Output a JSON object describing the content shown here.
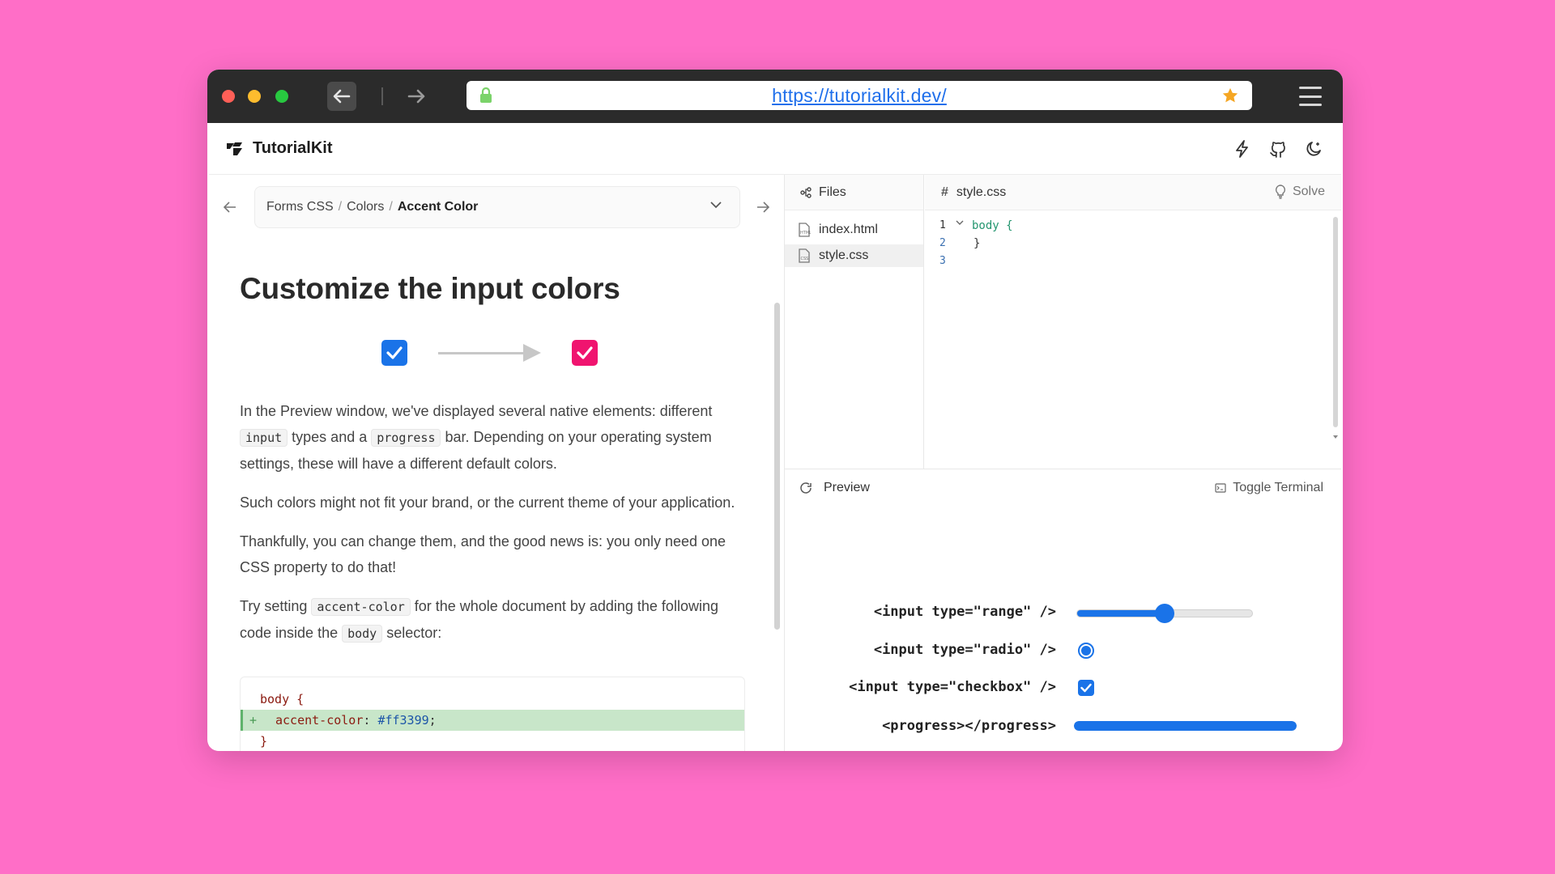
{
  "browser": {
    "url": "https://tutorialkit.dev/"
  },
  "app": {
    "brand": "TutorialKit"
  },
  "breadcrumb": {
    "items": [
      "Forms CSS",
      "Colors",
      "Accent Color"
    ],
    "separator": "/"
  },
  "lesson": {
    "title": "Customize the input colors",
    "p1_a": "In the Preview window, we've displayed several native elements: different ",
    "p1_code1": "input",
    "p1_b": " types and a ",
    "p1_code2": "progress",
    "p1_c": " bar. Depending on your operating system settings, these will have a different default colors.",
    "p2": "Such colors might not fit your brand, or the current theme of your application.",
    "p3": "Thankfully, you can change them, and the good news is: you only need one CSS property to do that!",
    "p4_a": "Try setting ",
    "p4_code1": "accent-color",
    "p4_b": " for the whole document by adding the following code inside the ",
    "p4_code2": "body",
    "p4_c": " selector:",
    "code": {
      "line1": "body {",
      "plus": "+",
      "prop": "accent-color",
      "colon": ": ",
      "value": "#ff3399",
      "semi": ";",
      "line3": "}"
    }
  },
  "files": {
    "header": "Files",
    "items": [
      "index.html",
      "style.css"
    ],
    "active": "style.css"
  },
  "editor": {
    "tab": "style.css",
    "solve": "Solve",
    "line_numbers": [
      "1",
      "2",
      "3"
    ],
    "lines": [
      "body {",
      "}",
      ""
    ]
  },
  "preview": {
    "header": "Preview",
    "toggle_terminal": "Toggle Terminal",
    "rows": [
      "<input type=\"range\" />",
      "<input type=\"radio\" />",
      "<input type=\"checkbox\" />",
      "<progress></progress>"
    ],
    "range_value": 0.5,
    "progress_value": 1.0
  },
  "colors": {
    "background": "#ff6ec7",
    "accent_default": "#1a73e8",
    "accent_target": "#f0146f"
  }
}
